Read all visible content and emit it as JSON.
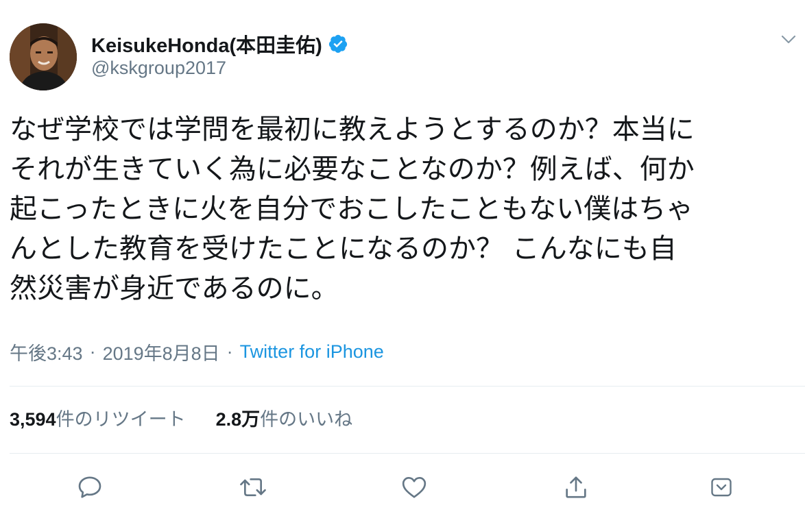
{
  "user": {
    "display_name": "KeisukeHonda(本田圭佑)",
    "handle": "@kskgroup2017",
    "verified": true
  },
  "tweet": {
    "lines": [
      "なぜ学校では学問を最初に教えようとするのか？本当に",
      "それが生きていく為に必要なことなのか？例えば、何か",
      "起こったときに火を自分でおこしたこともない僕はちゃ",
      "んとした教育を受けたことになるのか？ こんなにも自",
      "然災害が身近であるのに。"
    ]
  },
  "meta": {
    "time": "午後3:43",
    "separator": "·",
    "date": "2019年8月8日",
    "source": "Twitter for iPhone"
  },
  "stats": {
    "retweets": {
      "count": "3,594",
      "label": "件のリツイート"
    },
    "likes": {
      "count": "2.8万",
      "label": "件のいいね"
    }
  },
  "colors": {
    "text": "#14171a",
    "secondary": "#657786",
    "accent": "#1b95e0",
    "verified": "#1da1f2",
    "divider": "#e6ecf0"
  },
  "icons": {
    "caret": "chevron-down-icon",
    "verified": "verified-badge-icon",
    "reply": "reply-icon",
    "retweet": "retweet-icon",
    "like": "heart-icon",
    "share": "share-icon",
    "save": "bookmark-icon"
  }
}
